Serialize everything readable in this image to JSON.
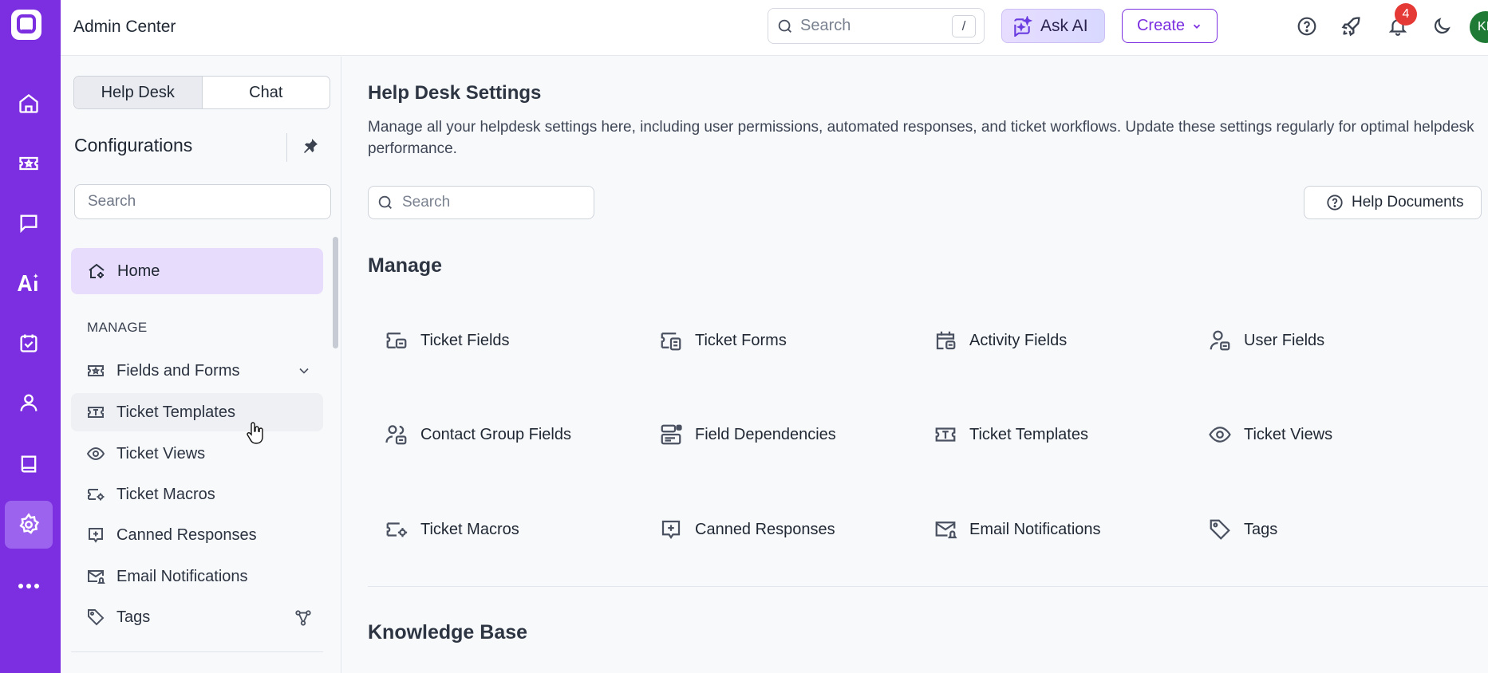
{
  "header": {
    "title": "Admin Center",
    "search_placeholder": "Search",
    "search_shortcut": "/",
    "ask_ai_label": "Ask AI",
    "create_label": "Create",
    "notification_count": "4",
    "avatar_initials": "KI"
  },
  "rail": {
    "items": [
      "logo-icon",
      "home-icon",
      "ticket-icon",
      "chat-icon",
      "ai-icon",
      "calendar-check-icon",
      "user-icon",
      "book-icon",
      "settings-icon",
      "more-icon"
    ],
    "active": "settings-icon",
    "color": "#7b2fe0"
  },
  "sidebar": {
    "tabs": [
      "Help Desk",
      "Chat"
    ],
    "active_tab": "Help Desk",
    "title": "Configurations",
    "search_placeholder": "Search",
    "home_label": "Home",
    "section_label": "MANAGE",
    "items": [
      {
        "label": "Fields and Forms",
        "icon": "fields-forms-icon"
      },
      {
        "label": "Ticket Templates",
        "icon": "ticket-template-icon"
      },
      {
        "label": "Ticket Views",
        "icon": "eye-icon"
      },
      {
        "label": "Ticket Macros",
        "icon": "ticket-macro-icon"
      },
      {
        "label": "Canned Responses",
        "icon": "canned-response-icon"
      },
      {
        "label": "Email Notifications",
        "icon": "email-notification-icon"
      },
      {
        "label": "Tags",
        "icon": "tag-icon"
      }
    ]
  },
  "main": {
    "title": "Help Desk Settings",
    "description": "Manage all your helpdesk settings here, including user permissions, automated responses, and ticket workflows. Update these settings regularly for optimal helpdesk performance.",
    "search_placeholder": "Search",
    "help_docs_label": "Help Documents",
    "manage_heading": "Manage",
    "manage_items": [
      {
        "label": "Ticket Fields",
        "icon": "ticket-fields-icon"
      },
      {
        "label": "Ticket Forms",
        "icon": "ticket-forms-icon"
      },
      {
        "label": "Activity Fields",
        "icon": "activity-fields-icon"
      },
      {
        "label": "User Fields",
        "icon": "user-fields-icon"
      },
      {
        "label": "Contact Group Fields",
        "icon": "contact-group-fields-icon"
      },
      {
        "label": "Field Dependencies",
        "icon": "field-dependencies-icon"
      },
      {
        "label": "Ticket Templates",
        "icon": "ticket-template-icon"
      },
      {
        "label": "Ticket Views",
        "icon": "eye-icon"
      },
      {
        "label": "Ticket Macros",
        "icon": "ticket-macro-icon"
      },
      {
        "label": "Canned Responses",
        "icon": "canned-response-icon"
      },
      {
        "label": "Email Notifications",
        "icon": "email-notification-icon"
      },
      {
        "label": "Tags",
        "icon": "tag-icon"
      }
    ],
    "knowledge_heading": "Knowledge Base"
  }
}
